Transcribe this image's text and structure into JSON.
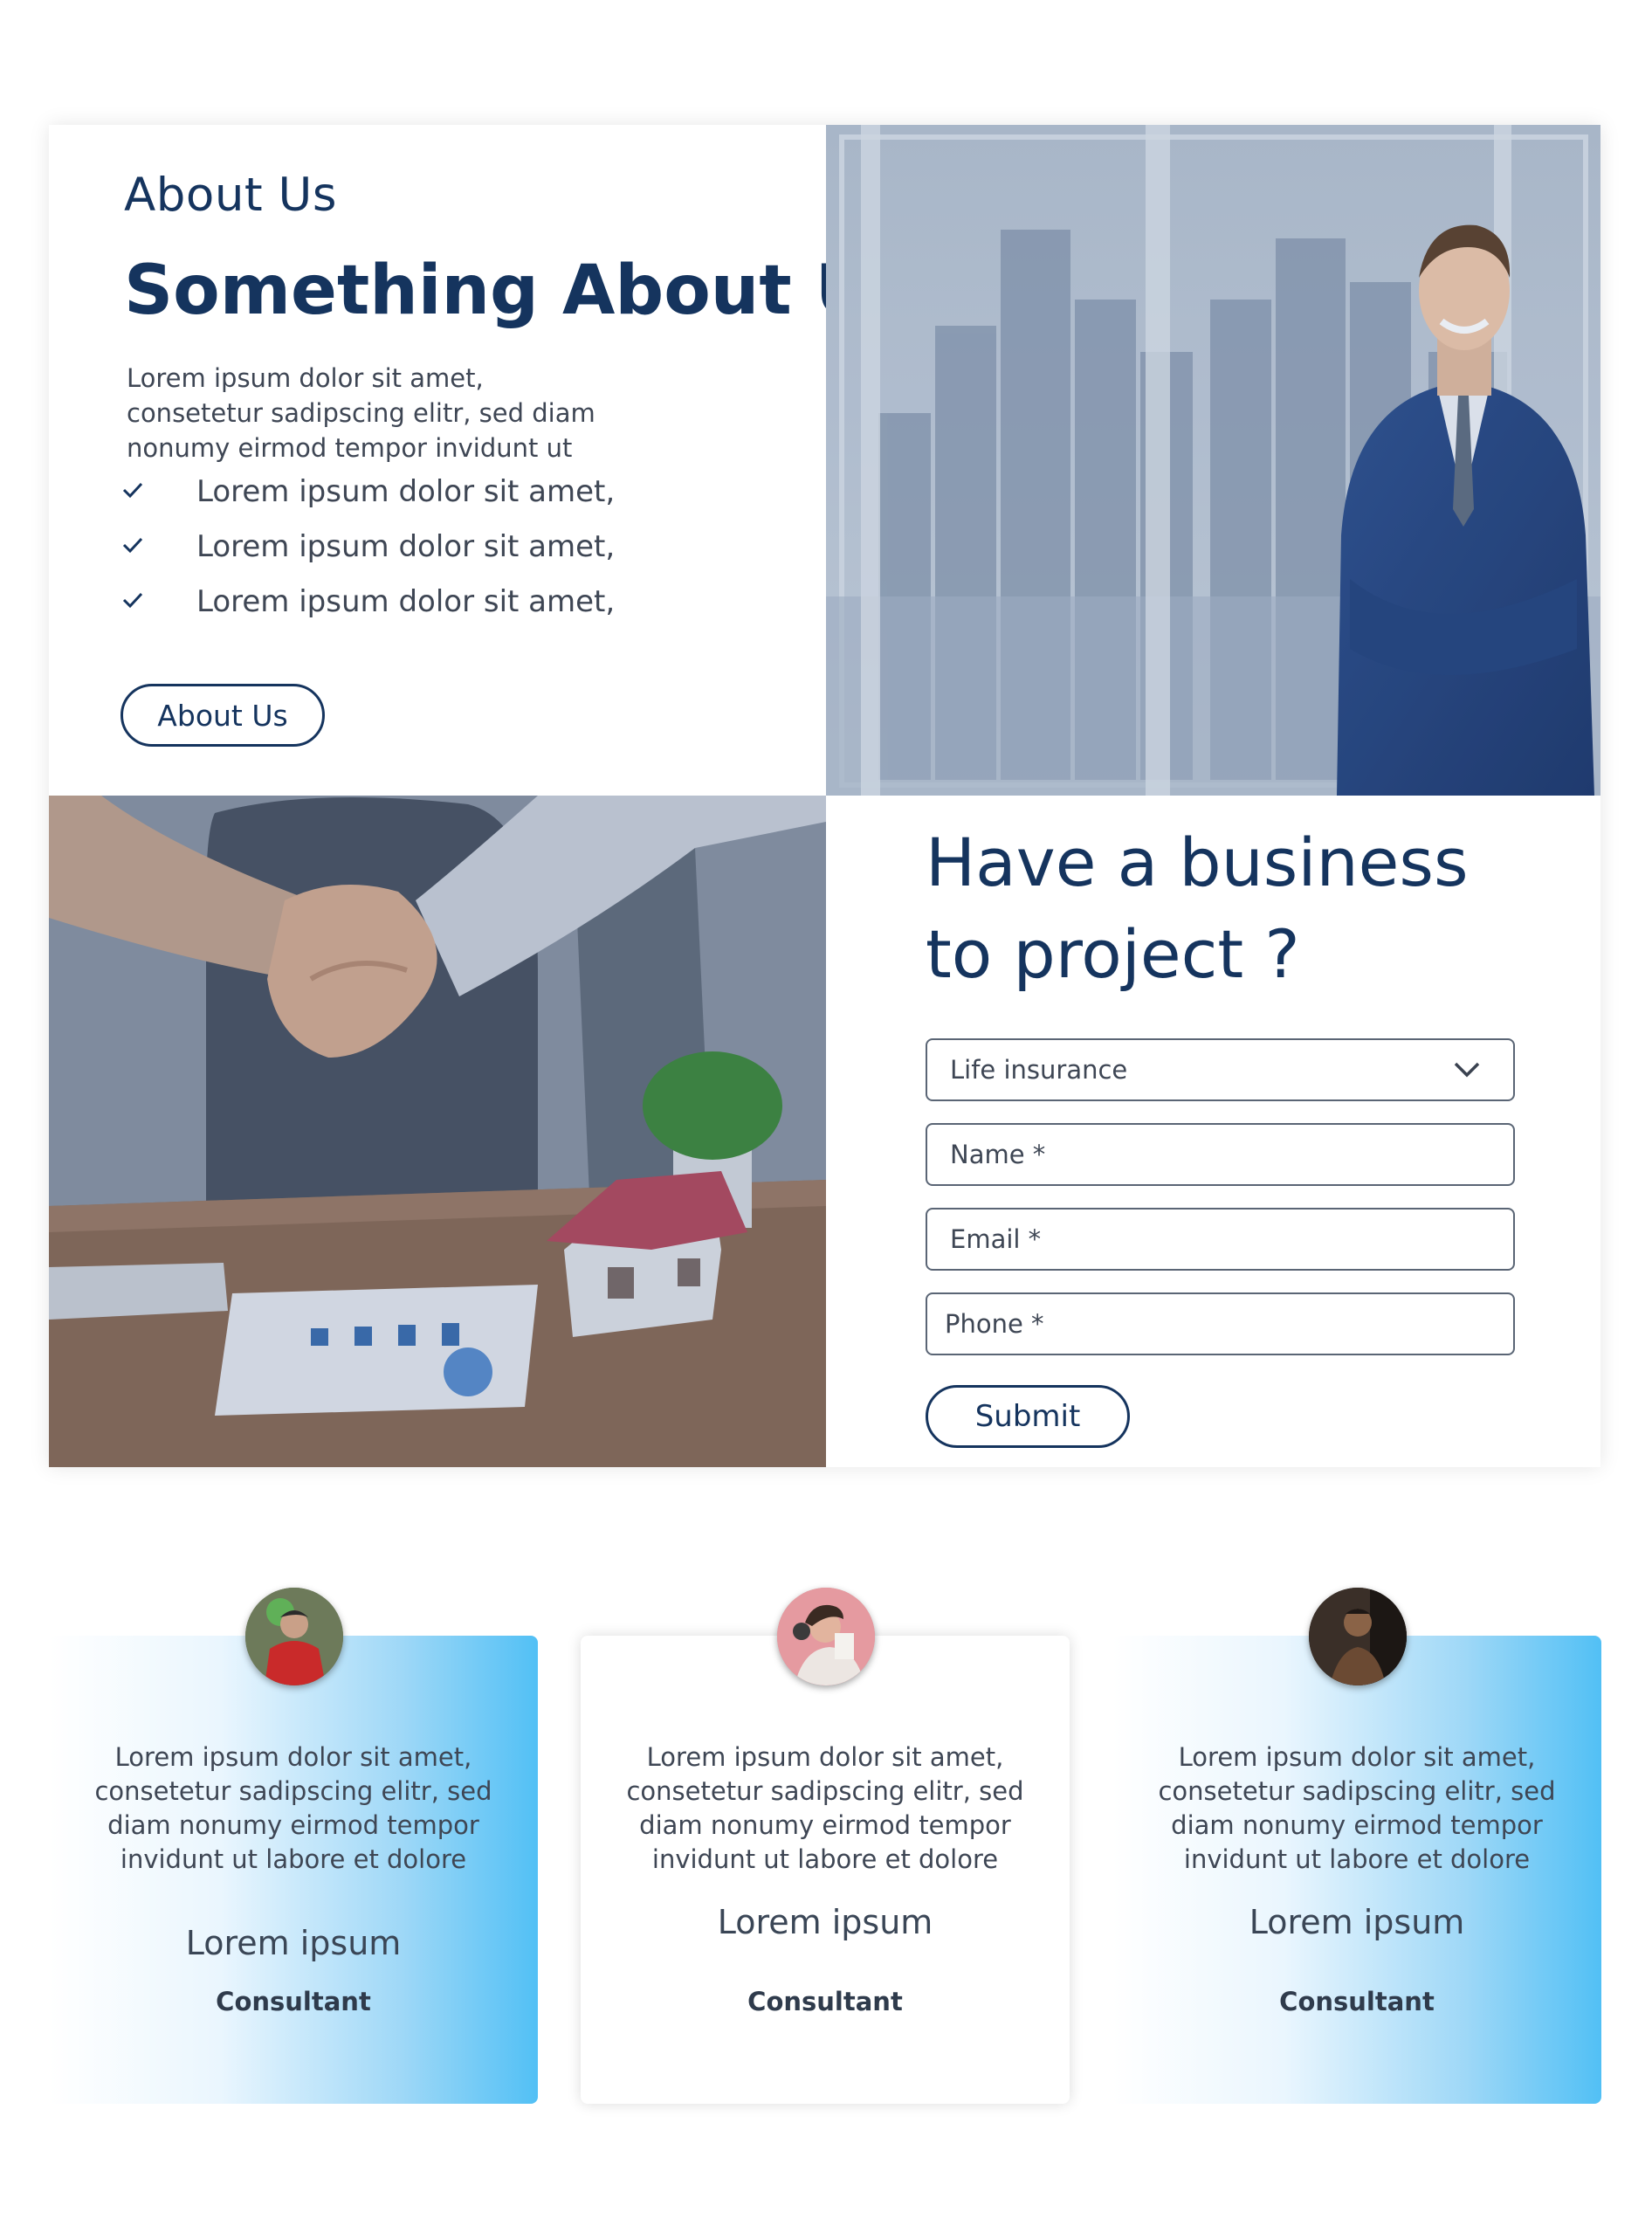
{
  "about": {
    "eyebrow": "About Us",
    "title": "Something About Us",
    "description": "Lorem ipsum dolor sit amet, consetetur sadipscing elitr, sed diam nonumy eirmod tempor invidunt ut",
    "list": [
      "Lorem ipsum dolor sit amet,",
      "Lorem ipsum dolor sit amet,",
      "Lorem ipsum dolor sit amet,"
    ],
    "button_label": "About Us"
  },
  "form": {
    "title": "Have a business to project ?",
    "select_value": "Life insurance",
    "name_placeholder": "Name *",
    "email_placeholder": "Email *",
    "phone_placeholder": "Phone *",
    "submit_label": "Submit"
  },
  "testimonials": [
    {
      "text": "Lorem ipsum dolor sit amet, consetetur sadipscing elitr, sed diam nonumy eirmod tempor invidunt ut labore et dolore",
      "name": "Lorem ipsum",
      "role": "Consultant"
    },
    {
      "text": "Lorem ipsum dolor sit amet, consetetur sadipscing elitr, sed diam nonumy eirmod tempor invidunt ut labore et dolore",
      "name": "Lorem ipsum",
      "role": "Consultant"
    },
    {
      "text": "Lorem ipsum dolor sit amet, consetetur sadipscing elitr, sed diam nonumy eirmod tempor invidunt ut labore et dolore",
      "name": "Lorem ipsum",
      "role": "Consultant"
    }
  ],
  "colors": {
    "brand": "#15345e",
    "text": "#3e4654",
    "card_gradient_end": "#52c0f5"
  },
  "icons": {
    "check": "check-icon",
    "dropdown": "chevron-down-icon"
  }
}
